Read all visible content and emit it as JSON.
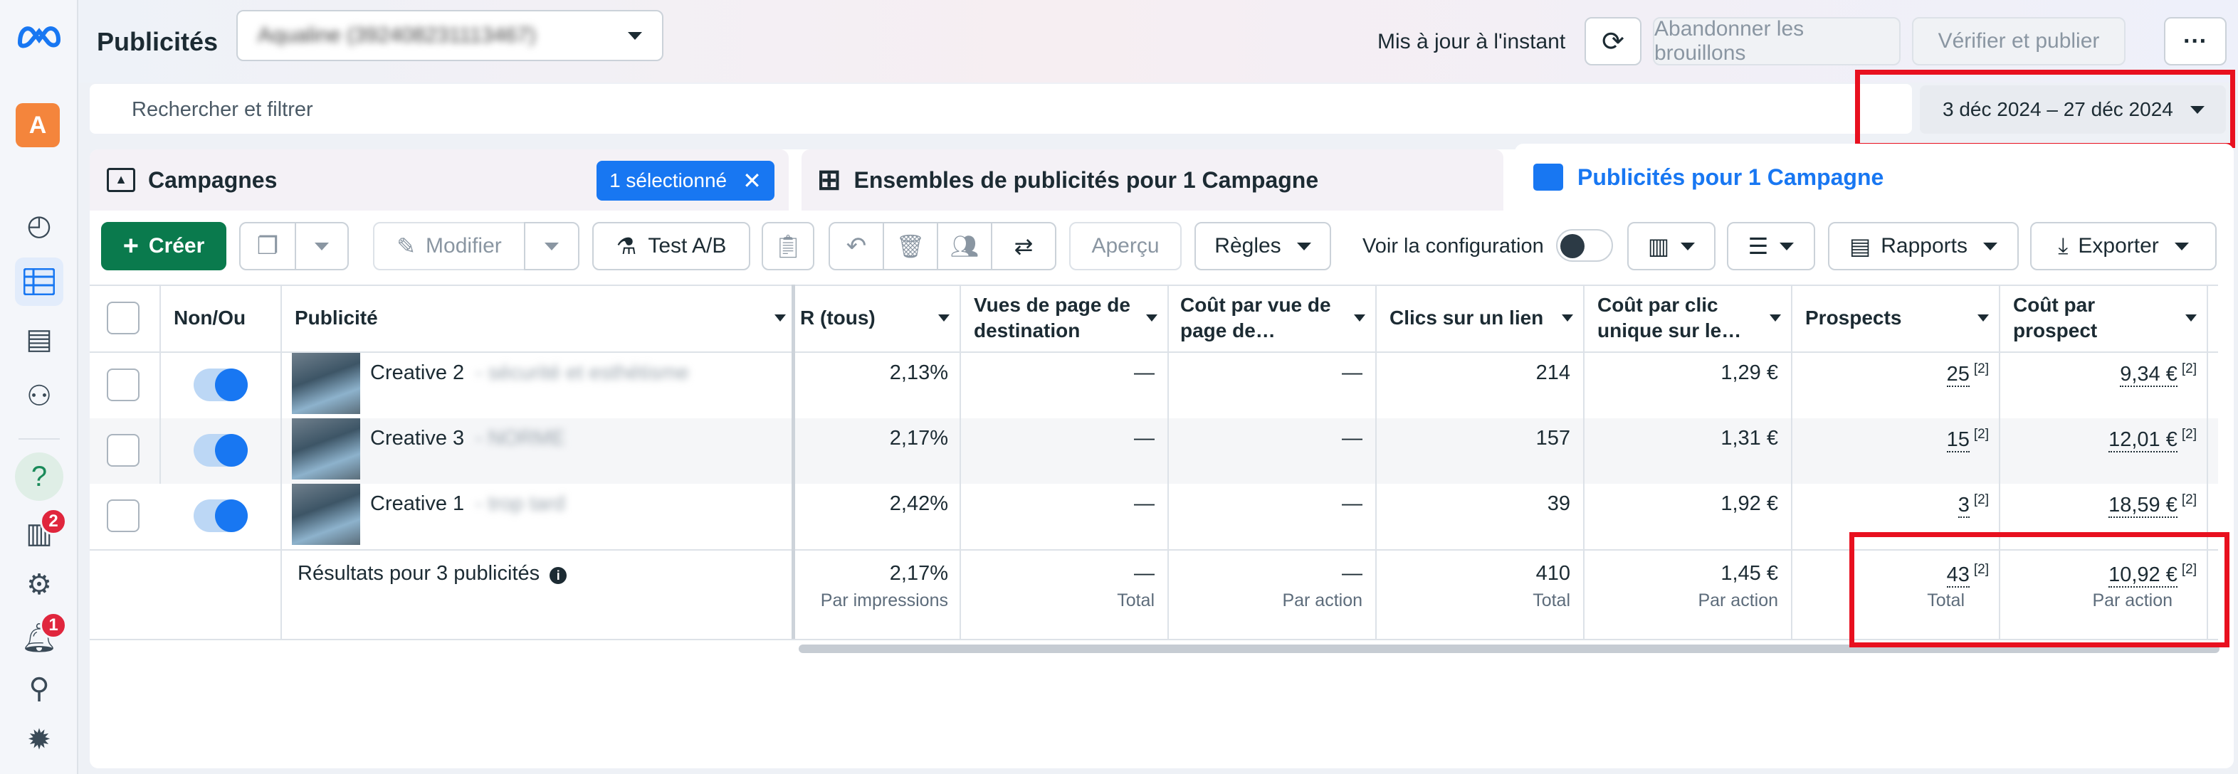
{
  "app": {
    "title": "Publicités",
    "account_selector": "Aqualine (392408231113467)",
    "avatar_letter": "A"
  },
  "header": {
    "updated_label": "Mis à jour à l'instant",
    "discard_label": "Abandonner les brouillons",
    "publish_label": "Vérifier et publier"
  },
  "search": {
    "placeholder": "Rechercher et filtrer",
    "date_range": "3 déc 2024 – 27 déc 2024"
  },
  "sidebar": {
    "badge_pages": "2",
    "badge_notifications": "1"
  },
  "tabs": {
    "campaigns": "Campagnes",
    "selected_chip": "1 sélectionné",
    "adsets": "Ensembles de publicités pour 1 Campagne",
    "ads": "Publicités pour 1 Campagne"
  },
  "toolbar": {
    "create": "Créer",
    "edit": "Modifier",
    "ab_test": "Test A/B",
    "preview": "Aperçu",
    "rules": "Règles",
    "config": "Voir la configuration",
    "reports": "Rapports",
    "export": "Exporter"
  },
  "table": {
    "headers": {
      "onoff": "Non/Ou",
      "ad": "Publicité",
      "ctr": "R (tous)",
      "lpv1": "Vues de page de",
      "lpv2": "destination",
      "cplpv1": "Coût par vue de",
      "cplpv2": "page de…",
      "clicks": "Clics sur un lien",
      "cpuc1": "Coût par clic",
      "cpuc2": "unique sur le…",
      "leads": "Prospects",
      "cpl1": "Coût par",
      "cpl2": "prospect"
    },
    "rows": [
      {
        "name": "Creative 2",
        "name_extra": "- sécurité et esthétisme",
        "ctr": "2,13%",
        "lpv": "—",
        "cplpv": "—",
        "clicks": "214",
        "cpuc": "1,29 €",
        "leads": "25",
        "cpl": "9,34 €"
      },
      {
        "name": "Creative 3",
        "name_extra": "- NORME",
        "ctr": "2,17%",
        "lpv": "—",
        "cplpv": "—",
        "clicks": "157",
        "cpuc": "1,31 €",
        "leads": "15",
        "cpl": "12,01 €"
      },
      {
        "name": "Creative 1",
        "name_extra": "- trop tard",
        "ctr": "2,42%",
        "lpv": "—",
        "cplpv": "—",
        "clicks": "39",
        "cpuc": "1,92 €",
        "leads": "3",
        "cpl": "18,59 €"
      }
    ],
    "footnote": "[2]",
    "totals": {
      "label": "Résultats pour 3 publicités",
      "ctr": "2,17%",
      "ctr_sub": "Par impressions",
      "lpv": "—",
      "lpv_sub": "Total",
      "cplpv": "—",
      "cplpv_sub": "Par action",
      "clicks": "410",
      "clicks_sub": "Total",
      "cpuc": "1,45 €",
      "cpuc_sub": "Par action",
      "leads": "43",
      "leads_sub": "Total",
      "cpl": "10,92 €",
      "cpl_sub": "Par action"
    }
  },
  "colors": {
    "brand": "#1877f2",
    "create_button": "#0a7a4d",
    "highlight": "#e8101f",
    "toggle": "#1877f2"
  }
}
